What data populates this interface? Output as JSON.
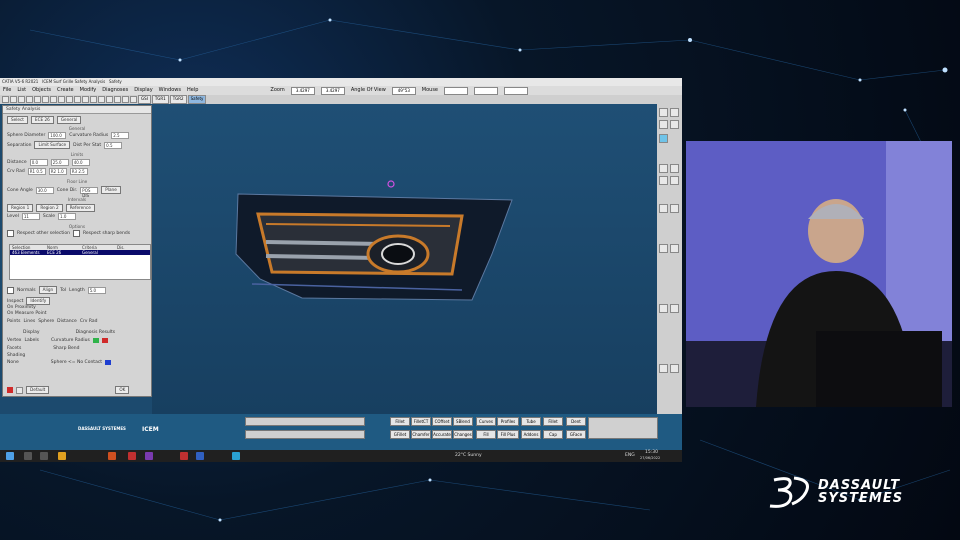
{
  "app": {
    "title_left": "CATIA V5-6 R2021",
    "window_title": "ICEM Surf Grille Safety Analysis",
    "title_right": "Safety"
  },
  "menu": {
    "items": [
      "File",
      "List",
      "Objects",
      "Create",
      "Modify",
      "Diagnoses",
      "Display",
      "Windows",
      "Help"
    ],
    "zoom_label": "Zoom",
    "zoom_value_1": "3.4297",
    "zoom_value_2": "3.4297",
    "angle_label": "Angle Of View",
    "angle_value": "49°53",
    "mouse_label": "Mouse"
  },
  "toolbar": {
    "tab_labels": [
      "GSI",
      "TGR1",
      "TGR2",
      "Safety"
    ]
  },
  "panel": {
    "title": "Safety Analysis",
    "select_label": "Select",
    "ece_label": "ECE 26",
    "general_dropdown": "General",
    "general_header": "General",
    "sphere_diameter_label": "Sphere Diameter",
    "sphere_diameter_value": "100.0",
    "curvature_radius_label": "Curvature Radius",
    "curvature_radius_value": "2.5",
    "separation_label": "Separation",
    "limit_surface_label": "Limit Surface",
    "dist_per_stat_label": "Dist Per Stat",
    "dist_per_stat_value": "0.5",
    "limits_header": "Limits",
    "distance_label": "Distance",
    "dist_values": [
      "0.0",
      "25.0",
      "40.0"
    ],
    "crv_rad_label": "Crv Rad",
    "crv_rad_values": [
      "R1 0.5",
      "R2 1.0",
      "R3 2.5"
    ],
    "floor_line_header": "Floor Line",
    "cone_angle_label": "Cone Angle",
    "cone_angle_value": "30.0",
    "cone_dir_label": "Cone Dir.",
    "cone_dir_value": "POS DIS",
    "plane_label": "Plane",
    "intervals_header": "Intervals",
    "region_labels": [
      "Region 1",
      "Region 2",
      "Reference"
    ],
    "level_label": "Level",
    "level_value": "11",
    "scale_label": "Scale",
    "scale_value": "1.0",
    "options_header": "Options",
    "respect_other_selection": "Respect other selection",
    "respect_sharp_bends": "Respect sharp bends",
    "grid_headers": [
      "Selection",
      "Norm",
      "Criteria",
      "Dis."
    ],
    "grid_row": [
      "463 Elements",
      "ECE 26",
      "General",
      ""
    ],
    "normals_label": "Normals",
    "align_label": "Align",
    "tol_label": "Tol",
    "length_label": "Length",
    "length_value": "5.0",
    "inspect_label": "Inspect",
    "identify_label": "Identify",
    "on_proximity": "On Proximity",
    "on_measure_point": "On Measure Point",
    "points_label": "Points",
    "lines_label": "Lines",
    "sphere_label": "Sphere",
    "distance_chk_label": "Distance",
    "crv_rad_chk_label": "Crv Rad",
    "display_header": "Display",
    "display_options": [
      "Vertex",
      "Facets",
      "Shading",
      "None"
    ],
    "labels_label": "Labels",
    "diagnosis_header": "Diagnosis Results",
    "diag_curvature": "Curvature Radius",
    "diag_sharp": "Sharp Bend",
    "diag_sphere": "Sphere <= No Contact",
    "default_label": "Default",
    "ok_label": "OK"
  },
  "bottom": {
    "brand_left": "DASSAULT SYSTEMES",
    "brand_right": "ICEM",
    "row1": [
      "Fillet",
      "FilletCT",
      "COffset",
      "SBlend",
      "Curves",
      "Profiles",
      "Tube",
      "Fillet",
      "Dent"
    ],
    "row2": [
      "GFillet",
      "Chamfer",
      "Accurate",
      "Changes",
      "Fill",
      "Fill Plus",
      "Addons",
      "Cap",
      "GFace"
    ]
  },
  "taskbar": {
    "weather": "22°C Sunny",
    "time": "15:30",
    "date": "27/06/2022",
    "lang": "ENG"
  },
  "brand": {
    "line1": "DASSAULT",
    "line2": "SYSTEMES"
  },
  "colors": {
    "viewport": "#1c4a6e",
    "accent_orange": "#c87a2a",
    "brand_white": "#ffffff"
  }
}
